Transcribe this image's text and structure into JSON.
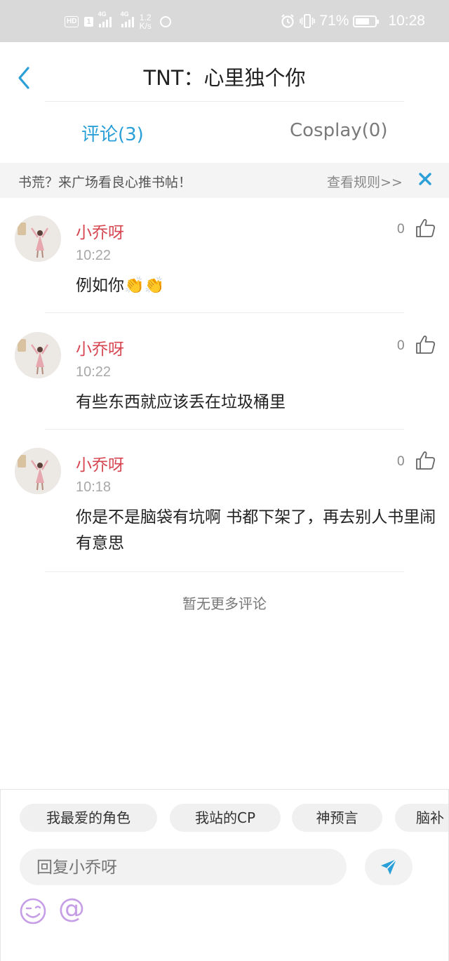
{
  "status_bar": {
    "hd": "HD",
    "sim": "1",
    "net1": "4G",
    "net2": "4G",
    "speed_value": "1.2",
    "speed_unit": "K/s",
    "battery": "71%",
    "battery_level": 0.71,
    "time": "10:28"
  },
  "header": {
    "title": "TNT：心里独个你"
  },
  "tabs": [
    {
      "label": "评论(3)",
      "active": true
    },
    {
      "label": "Cosplay(0)",
      "active": false
    }
  ],
  "banner": {
    "text": "书荒？来广场看良心推书帖！",
    "link": "查看规则>>"
  },
  "comments": [
    {
      "name": "小乔呀",
      "time": "10:22",
      "text": "例如你👏👏",
      "likes": "0"
    },
    {
      "name": "小乔呀",
      "time": "10:22",
      "text": "有些东西就应该丢在垃圾桶里",
      "likes": "0"
    },
    {
      "name": "小乔呀",
      "time": "10:18",
      "text": "你是不是脑袋有坑啊  书都下架了，再去别人书里闹  有意思",
      "likes": "0"
    }
  ],
  "no_more": "暂无更多评论",
  "topic_chips": [
    "我最爱的角色",
    "我站的CP",
    "神预言",
    "脑补"
  ],
  "reply": {
    "placeholder": "回复小乔呀"
  },
  "colors": {
    "accent": "#2a9fd8",
    "username": "#d64550",
    "status_bar_bg": "#d9d9d9",
    "at_icon": "#c59ee6"
  },
  "icons": [
    "back-arrow-icon",
    "close-icon",
    "thumbs-up-icon",
    "send-icon",
    "emoji-icon",
    "at-icon",
    "alarm-icon",
    "vibrate-icon",
    "battery-icon",
    "signal-icon",
    "loading-ring-icon"
  ]
}
